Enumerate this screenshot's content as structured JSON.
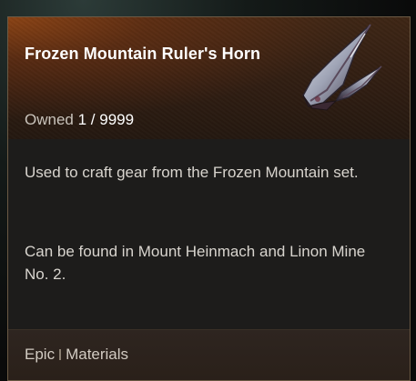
{
  "tooltip": {
    "title": "Frozen Mountain Ruler's Horn",
    "owned_label": "Owned",
    "owned_count": "1 / 9999",
    "description_1": "Used to craft gear from the Frozen Mountain set.",
    "description_2": "Can be found in Mount Heinmach and Linon Mine No. 2.",
    "rarity": "Epic",
    "category": "Materials",
    "icon": "frozen-horn-icon",
    "header_color": "#3e2615",
    "accent_color": "#c85a14"
  }
}
